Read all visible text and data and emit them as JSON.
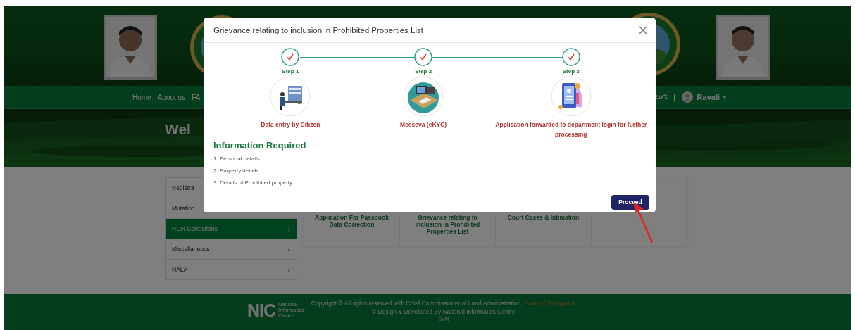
{
  "nav": {
    "items": [
      "Home",
      "About us",
      "FA"
    ],
    "language": "లుగు",
    "user": "Ravali"
  },
  "banner": {
    "heading": "Wel"
  },
  "sidebar": {
    "items": [
      {
        "label": "Registra",
        "selected": false
      },
      {
        "label": "Mutation",
        "selected": false
      },
      {
        "label": "ROR Corrections",
        "selected": true,
        "chevron": "›"
      },
      {
        "label": "Miscellaneous",
        "selected": false,
        "chevron": "›"
      },
      {
        "label": "NALA",
        "selected": false,
        "chevron": "›"
      }
    ]
  },
  "cards": [
    {
      "label": "Application For Passbook Data Correction"
    },
    {
      "label": "Grievance relating to inclusion in Prohibited Properties List"
    },
    {
      "label": "Court Cases & Intimation"
    }
  ],
  "footer": {
    "logo_mark": "NIC",
    "logo_text": [
      "National",
      "Informatics",
      "Centre"
    ],
    "copyright": "Copyright © All rights reserved with Chief Commissioner of Land Administration, ",
    "copyright_link": "Govt. of Telangana",
    "copyright_end": ".",
    "credit": "© Design & Developed By ",
    "credit_link": "National Informatics Centre",
    "code": "SVM"
  },
  "modal": {
    "title": "Grievance relating to inclusion in Prohibited Properties List",
    "close": "×",
    "steps": [
      {
        "label": "Step 1",
        "caption": "Data entry by Citizen",
        "done": true
      },
      {
        "label": "Step 2",
        "caption": "Meeseva (eKYC)",
        "done": true
      },
      {
        "label": "Step 3",
        "caption": "Application forwarded to department login for further processing",
        "done": true
      }
    ],
    "info_heading": "Information Required",
    "info_items": [
      "1. Personal details",
      "2. Property details",
      "3. Details of Prohibited property"
    ],
    "proceed_button": "Proceed"
  }
}
